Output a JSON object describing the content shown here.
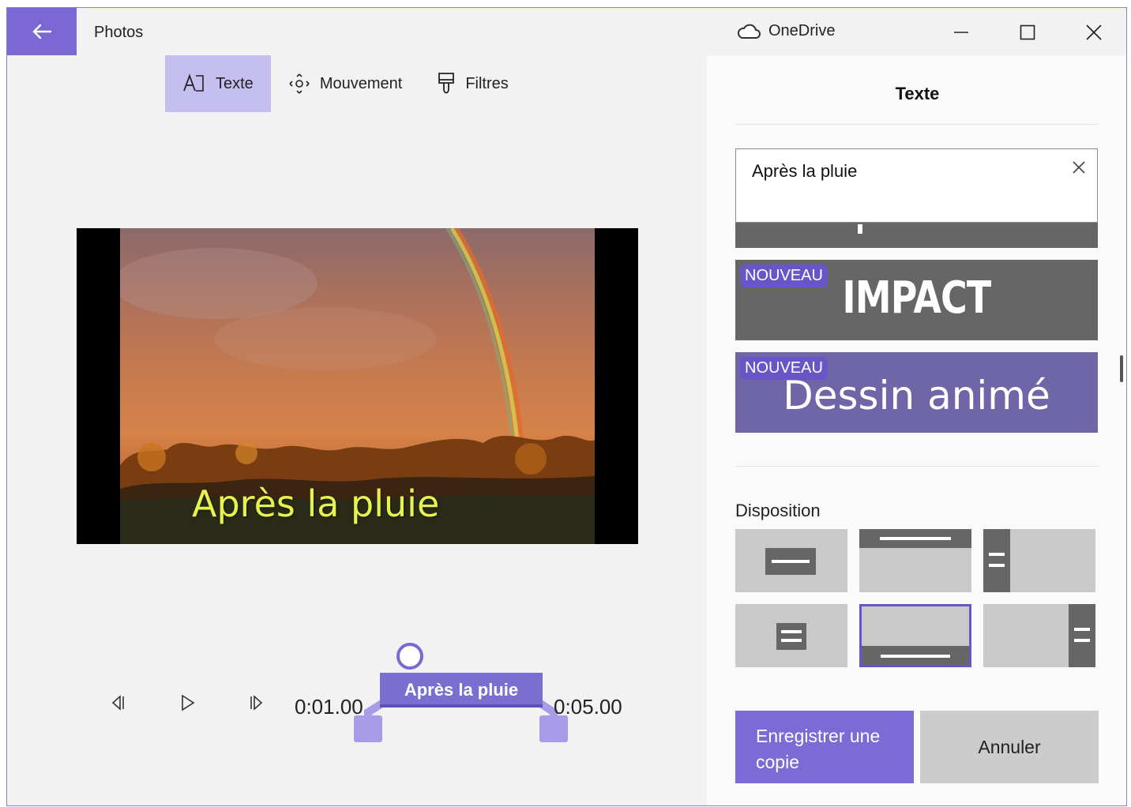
{
  "app": {
    "title": "Photos"
  },
  "titlebar": {
    "onedrive_label": "OneDrive"
  },
  "toolbar": {
    "tabs": [
      {
        "label": "Texte"
      },
      {
        "label": "Mouvement"
      },
      {
        "label": "Filtres"
      }
    ]
  },
  "preview": {
    "overlay_text": "Après la pluie"
  },
  "playback": {
    "start_time": "0:01.00",
    "end_time": "0:05.00",
    "clip_label": "Après la pluie"
  },
  "panel": {
    "title": "Texte",
    "text_input_value": "Après la pluie",
    "styles": [
      {
        "badge": "NOUVEAU",
        "label": "IMPACT",
        "bg": "#666666"
      },
      {
        "badge": "NOUVEAU",
        "label": "Dessin animé",
        "bg": "#6f66a8"
      }
    ],
    "disposition_label": "Disposition",
    "save_label": "Enregistrer une copie",
    "cancel_label": "Annuler"
  },
  "colors": {
    "accent": "#7b68d4",
    "accent_light": "#c5bfef",
    "overlay_text": "#e6f24e"
  }
}
